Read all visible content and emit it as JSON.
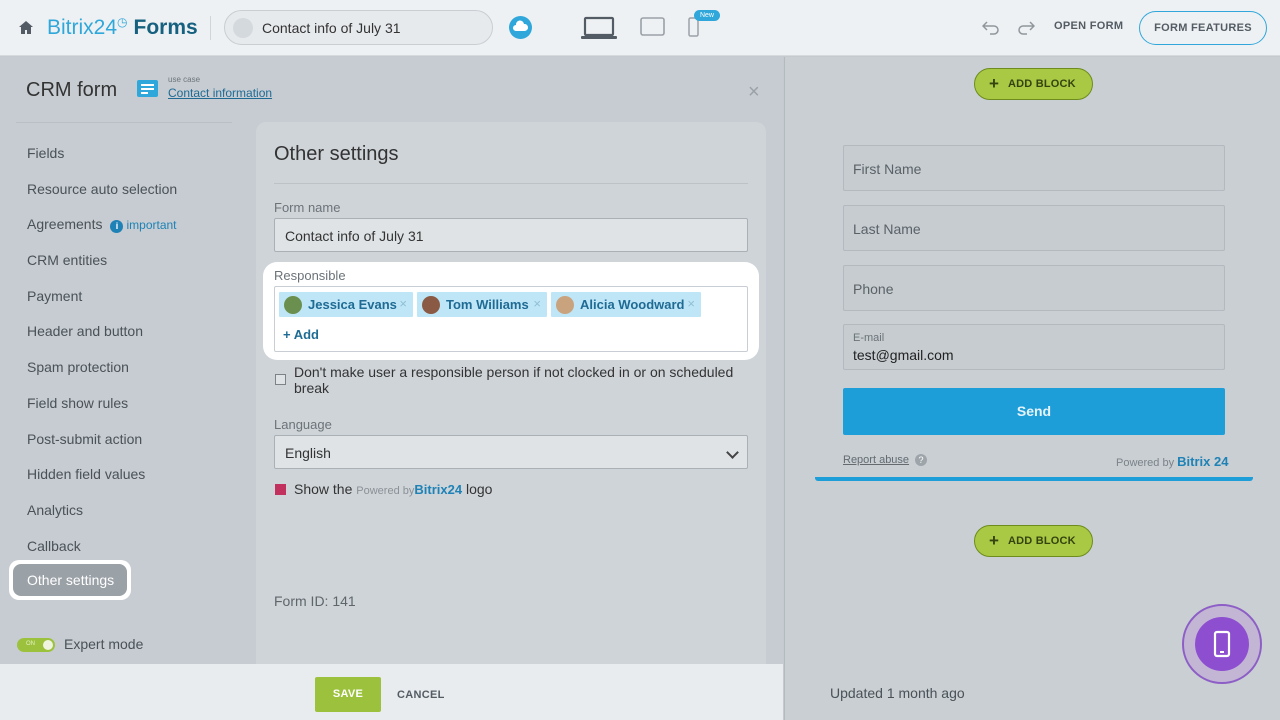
{
  "topbar": {
    "logo_brand": "Bitrix24",
    "logo_clock": "◷",
    "logo_product": "Forms",
    "form_title": "Contact info of July 31",
    "new_badge": "New",
    "open_form": "OPEN FORM",
    "form_features": "FORM FEATURES"
  },
  "sidebar": {
    "title": "CRM form",
    "use_case_label": "use case",
    "use_case_link": "Contact information",
    "items": [
      {
        "label": "Fields"
      },
      {
        "label": "Resource auto selection"
      },
      {
        "label": "Agreements",
        "badge": "important"
      },
      {
        "label": "CRM entities"
      },
      {
        "label": "Payment"
      },
      {
        "label": "Header and button"
      },
      {
        "label": "Spam protection"
      },
      {
        "label": "Field show rules"
      },
      {
        "label": "Post-submit action"
      },
      {
        "label": "Hidden field values"
      },
      {
        "label": "Analytics"
      },
      {
        "label": "Callback"
      }
    ],
    "active_item": "Other settings",
    "expert_toggle_text": "ON",
    "expert_mode": "Expert mode"
  },
  "settings": {
    "title": "Other settings",
    "form_name_label": "Form name",
    "form_name_value": "Contact info of July 31",
    "responsible_label": "Responsible",
    "responsible": [
      {
        "name": "Jessica Evans",
        "avatar_color": "#6b8f4e"
      },
      {
        "name": "Tom Williams",
        "avatar_color": "#8a5a44"
      },
      {
        "name": "Alicia Woodward",
        "avatar_color": "#c9a27e"
      }
    ],
    "add_label": "+ Add",
    "checkbox_label": "Don't make user a responsible person if not clocked in or on scheduled break",
    "language_label": "Language",
    "language_value": "English",
    "show_logo_prefix": "Show the",
    "show_logo_powered": "Powered by",
    "show_logo_brand": "Bitrix24",
    "show_logo_suffix": "logo",
    "form_id": "Form ID: 141"
  },
  "footer": {
    "save": "SAVE",
    "cancel": "CANCEL"
  },
  "preview": {
    "add_block": "ADD BLOCK",
    "first_name": "First Name",
    "last_name": "Last Name",
    "phone": "Phone",
    "email_label": "E-mail",
    "email_value": "test@gmail.com",
    "send": "Send",
    "report_abuse": "Report abuse",
    "powered_by": "Powered by",
    "brand": "Bitrix 24",
    "updated": "Updated 1 month ago"
  },
  "colors": {
    "accent": "#2fa7da",
    "green": "#9cc23d",
    "purple": "#8d4fd0"
  }
}
